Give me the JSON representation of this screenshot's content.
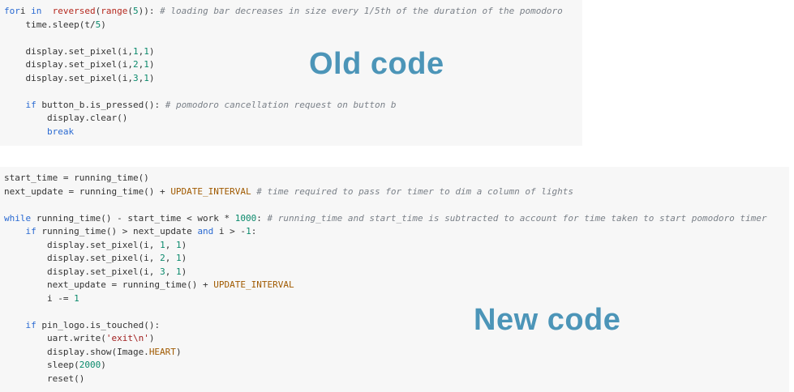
{
  "labels": {
    "old": "Old code",
    "new": "New code"
  },
  "colors": {
    "label": "#4c95b8",
    "keyword": "#2a6ad2",
    "builtin": "#b5281e",
    "number": "#0b8a6c",
    "string": "#a01f1f",
    "constant": "#a05a00",
    "comment": "#7a8088",
    "panel_bg": "#f7f7f7"
  },
  "old_code": [
    [
      [
        "kw",
        "for"
      ],
      [
        "",
        "i "
      ],
      [
        "kw",
        "in"
      ],
      [
        "",
        "  "
      ],
      [
        "bi",
        "reversed"
      ],
      [
        "",
        "("
      ],
      [
        "bi",
        "range"
      ],
      [
        "",
        "("
      ],
      [
        "num",
        "5"
      ],
      [
        "",
        "))"
      ],
      [
        "",
        ": "
      ],
      [
        "cm",
        "# loading bar decreases in size every 1/5th of the duration of the pomodoro"
      ]
    ],
    [
      [
        "",
        "    time.sleep(t/"
      ],
      [
        "num",
        "5"
      ],
      [
        "",
        ")"
      ]
    ],
    [
      [
        "",
        ""
      ]
    ],
    [
      [
        "",
        "    display.set_pixel(i,"
      ],
      [
        "num",
        "1"
      ],
      [
        "",
        ","
      ],
      [
        "num",
        "1"
      ],
      [
        "",
        ")"
      ]
    ],
    [
      [
        "",
        "    display.set_pixel(i,"
      ],
      [
        "num",
        "2"
      ],
      [
        "",
        ","
      ],
      [
        "num",
        "1"
      ],
      [
        "",
        ")"
      ]
    ],
    [
      [
        "",
        "    display.set_pixel(i,"
      ],
      [
        "num",
        "3"
      ],
      [
        "",
        ","
      ],
      [
        "num",
        "1"
      ],
      [
        "",
        ")"
      ]
    ],
    [
      [
        "",
        ""
      ]
    ],
    [
      [
        "",
        "    "
      ],
      [
        "kw",
        "if"
      ],
      [
        "",
        " button_b.is_pressed(): "
      ],
      [
        "cm",
        "# pomodoro cancellation request on button b"
      ]
    ],
    [
      [
        "",
        "        display.clear()"
      ]
    ],
    [
      [
        "",
        "        "
      ],
      [
        "kw",
        "break"
      ]
    ]
  ],
  "new_code": [
    [
      [
        "",
        "start_time = running_time()"
      ]
    ],
    [
      [
        "",
        "next_update = running_time() + "
      ],
      [
        "const",
        "UPDATE_INTERVAL"
      ],
      [
        "cm",
        " # time required to pass for timer to dim a column of lights"
      ]
    ],
    [
      [
        "",
        ""
      ]
    ],
    [
      [
        "kw",
        "while"
      ],
      [
        "",
        " running_time() - start_time < work * "
      ],
      [
        "num",
        "1000"
      ],
      [
        "",
        ": "
      ],
      [
        "cm",
        "# running_time and start_time is subtracted to account for time taken to start pomodoro timer"
      ]
    ],
    [
      [
        "",
        "    "
      ],
      [
        "kw",
        "if"
      ],
      [
        "",
        " running_time() > next_update "
      ],
      [
        "kw",
        "and"
      ],
      [
        "",
        " i > -"
      ],
      [
        "num",
        "1"
      ],
      [
        "",
        ":"
      ]
    ],
    [
      [
        "",
        "        display.set_pixel(i, "
      ],
      [
        "num",
        "1"
      ],
      [
        "",
        ", "
      ],
      [
        "num",
        "1"
      ],
      [
        "",
        ")"
      ]
    ],
    [
      [
        "",
        "        display.set_pixel(i, "
      ],
      [
        "num",
        "2"
      ],
      [
        "",
        ", "
      ],
      [
        "num",
        "1"
      ],
      [
        "",
        ")"
      ]
    ],
    [
      [
        "",
        "        display.set_pixel(i, "
      ],
      [
        "num",
        "3"
      ],
      [
        "",
        ", "
      ],
      [
        "num",
        "1"
      ],
      [
        "",
        ")"
      ]
    ],
    [
      [
        "",
        "        next_update = running_time() + "
      ],
      [
        "const",
        "UPDATE_INTERVAL"
      ]
    ],
    [
      [
        "",
        "        i -= "
      ],
      [
        "num",
        "1"
      ]
    ],
    [
      [
        "",
        ""
      ]
    ],
    [
      [
        "",
        "    "
      ],
      [
        "kw",
        "if"
      ],
      [
        "",
        " pin_logo.is_touched():"
      ]
    ],
    [
      [
        "",
        "        uart.write("
      ],
      [
        "str",
        "'exit\\n'"
      ],
      [
        "",
        ")"
      ]
    ],
    [
      [
        "",
        "        display.show(Image."
      ],
      [
        "const",
        "HEART"
      ],
      [
        "",
        ")"
      ]
    ],
    [
      [
        "",
        "        sleep("
      ],
      [
        "num",
        "2000"
      ],
      [
        "",
        ")"
      ]
    ],
    [
      [
        "",
        "        reset()"
      ]
    ]
  ]
}
